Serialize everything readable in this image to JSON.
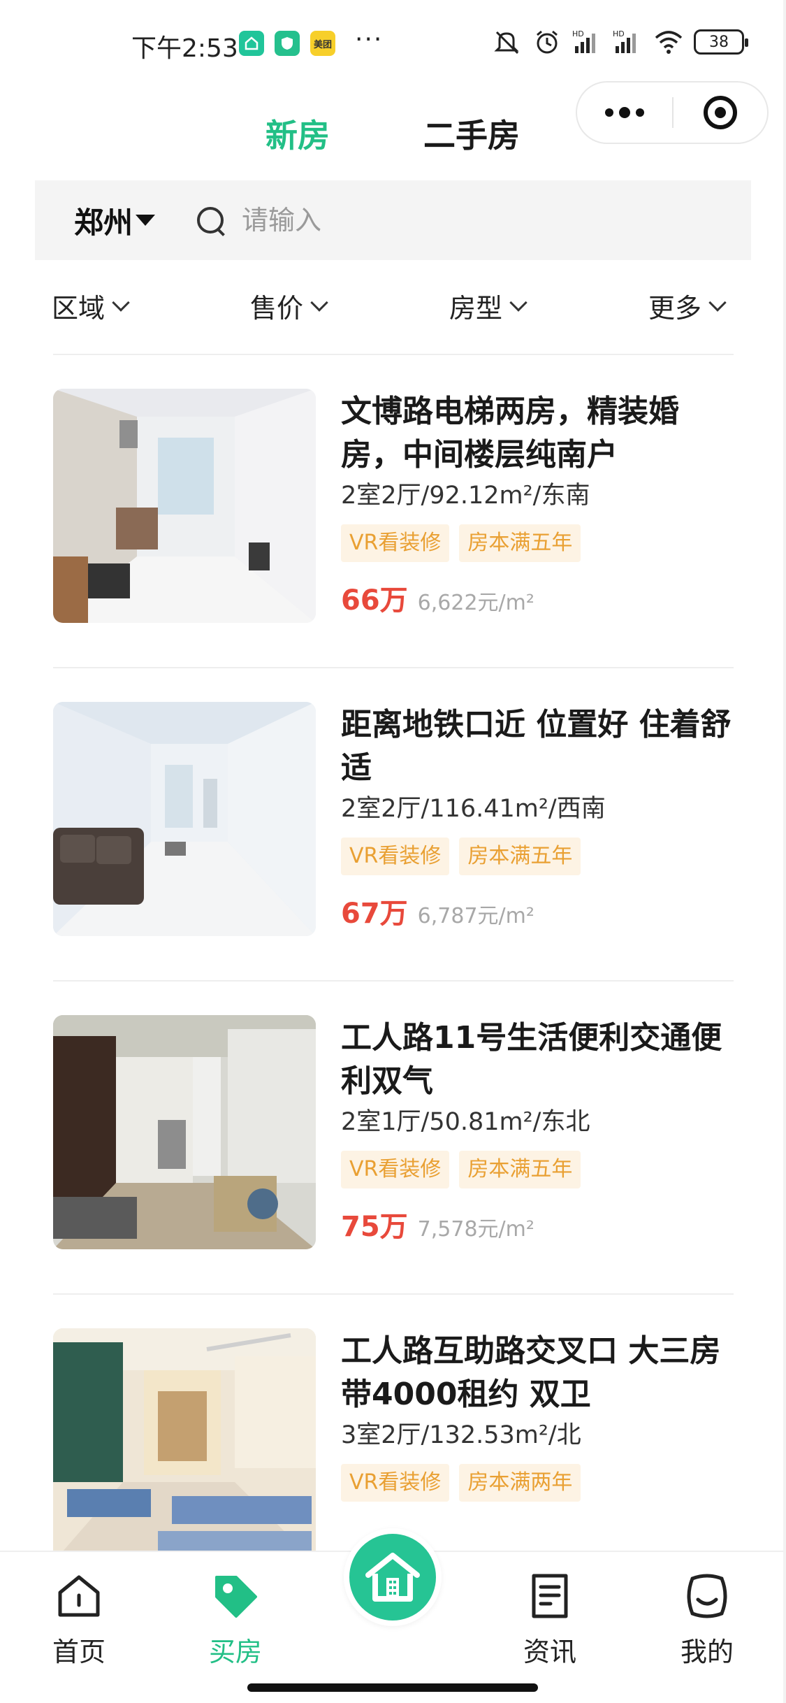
{
  "status_bar": {
    "time": "下午2:53",
    "more": "···",
    "battery": "38",
    "meituan_badge": "美团",
    "icons": [
      "app-green-house-icon",
      "app-green-shield-icon",
      "meituan-icon",
      "mute-bell-icon",
      "alarm-icon",
      "signal-hd-icon",
      "signal-hd-icon",
      "wifi-icon",
      "battery-icon"
    ]
  },
  "header": {
    "tab_new": "新房",
    "tab_used": "二手房",
    "active_tab_color": "#22bf86"
  },
  "search": {
    "city": "郑州",
    "placeholder": "请输入"
  },
  "filters": {
    "area": "区域",
    "price": "售价",
    "layout": "房型",
    "more": "更多"
  },
  "listings": [
    {
      "title": "文博路电梯两房，精装婚房，中间楼层纯南户",
      "meta": "2室2厅/92.12m²/东南",
      "tags": [
        "VR看装修",
        "房本满五年"
      ],
      "price": "66万",
      "unit_price": "6,622元/m²"
    },
    {
      "title": "距离地铁口近 位置好 住着舒适",
      "meta": "2室2厅/116.41m²/西南",
      "tags": [
        "VR看装修",
        "房本满五年"
      ],
      "price": "67万",
      "unit_price": "6,787元/m²"
    },
    {
      "title": "工人路11号生活便利交通便利双气",
      "meta": "2室1厅/50.81m²/东北",
      "tags": [
        "VR看装修",
        "房本满五年"
      ],
      "price": "75万",
      "unit_price": "7,578元/m²"
    },
    {
      "title": "工人路互助路交叉口 大三房 带4000租约 双卫",
      "meta": "3室2厅/132.53m²/北",
      "tags": [
        "VR看装修",
        "房本满两年"
      ],
      "price": "",
      "unit_price": ""
    }
  ],
  "bottom_nav": {
    "home": "首页",
    "buy": "买房",
    "news": "资讯",
    "mine": "我的"
  },
  "colors": {
    "brand_green": "#22bf86",
    "price_red": "#e8493b",
    "tag_bg": "#fdf3e4",
    "tag_text": "#e9a033"
  }
}
